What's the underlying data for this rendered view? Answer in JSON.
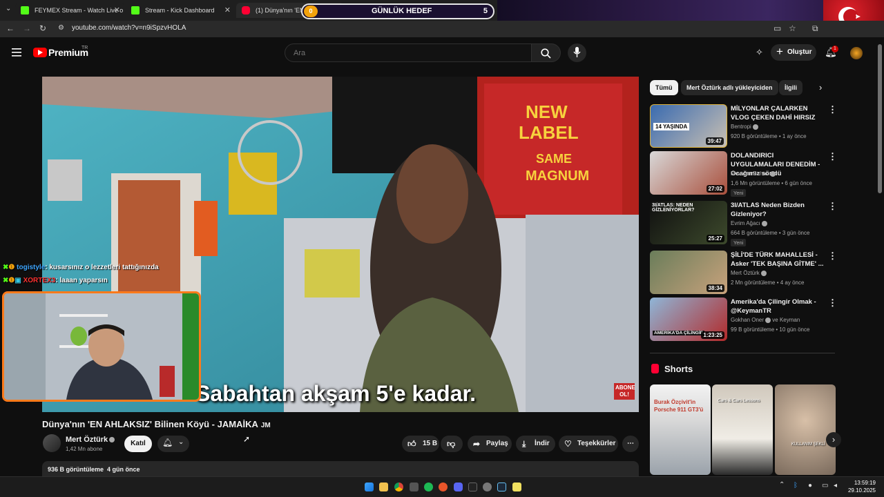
{
  "browser": {
    "tabs": [
      {
        "title": "FEYMEX Stream - Watch Live o",
        "color": "#53fc18"
      },
      {
        "title": "Stream - Kick Dashboard",
        "color": "#53fc18"
      },
      {
        "title": "(1) Dünya'nın 'EN AH",
        "color": "#ff0033"
      }
    ],
    "goal": {
      "label": "GÜNLÜK HEDEF",
      "current": "0",
      "target": "5"
    },
    "url": "youtube.com/watch?v=n9iSpzvHOLA"
  },
  "header": {
    "logo_text": "Premium",
    "logo_region": "TR",
    "search_placeholder": "Ara",
    "create_label": "Oluştur",
    "notif_count": "1"
  },
  "video": {
    "subtitle": "Sabahtan akşam 5'e kadar.",
    "watermark": "ABONE OL!",
    "title": "Dünya'nın 'EN AHLAKSIZ' Bilinen Köyü - JAMAİKA",
    "title_suffix": "JM",
    "channel": "Mert Öztürk",
    "subs": "1,42 Mn abone",
    "join_label": "Katıl",
    "likes": "15 B",
    "share_label": "Paylaş",
    "download_label": "İndir",
    "thanks_label": "Teşekkürler",
    "views": "936 B görüntüleme",
    "age": "4 gün önce"
  },
  "chat": [
    {
      "user": "togistyle",
      "text": ": kusarsınız o lezzetleri tattığınızda"
    },
    {
      "user": "XORTEX3",
      "text": ": laaan yaparsın"
    }
  ],
  "chips": [
    "Tümü",
    "Mert Öztürk adlı yükleyiciden",
    "İlgili"
  ],
  "recommendations": [
    {
      "title": "MİLYONLAR ÇALARKEN VLOG ÇEKEN DAHİ HIRSIZ",
      "channel": "Bentropi",
      "meta": "920 B görüntüleme • 1 ay önce",
      "duration": "39:47",
      "badge": "",
      "thumb_text": "14 YAŞINDA"
    },
    {
      "title": "DOLANDIRICI UYGULAMALARI DENEDİM - Ocağımız söndü",
      "channel": "Mevtcan Bahav",
      "meta": "1,6 Mn görüntüleme • 6 gün önce",
      "duration": "27:02",
      "badge": "Yeni",
      "thumb_text": ""
    },
    {
      "title": "3I/ATLAS Neden Bizden Gizleniyor?",
      "channel": "Evrim Ağacı",
      "meta": "664 B görüntüleme • 3 gün önce",
      "duration": "25:27",
      "badge": "Yeni",
      "thumb_text": "3I/ATLAS: NEDEN GİZLENİYORLAR?"
    },
    {
      "title": "ŞİLİ'DE TÜRK MAHALLESİ - Asker 'TEK BAŞINA GİTME' ...",
      "channel": "Mert Öztürk",
      "meta": "2 Mn görüntüleme • 4 ay önce",
      "duration": "38:34",
      "badge": "",
      "thumb_text": ""
    },
    {
      "title": "Amerika'da Çilingir Olmak - @KeymanTR",
      "channel": "Gokhan Oner",
      "channel_extra": "ve Keyman",
      "meta": "99 B görüntüleme • 10 gün önce",
      "duration": "1:23:25",
      "badge": "",
      "thumb_text": "AMERİKA'DA ÇİLİNGİR"
    }
  ],
  "shorts": {
    "label": "Shorts",
    "items": [
      {
        "text": "Burak Özçivit'in Porsche 911 GT3'ü"
      },
      {
        "text": "Cars & Cars Lessons"
      },
      {
        "text": "KULLANIM ŞEKLİ"
      }
    ]
  },
  "taskbar": {
    "time": "13:59:19",
    "date": "29.10.2025"
  },
  "colors": {
    "bg": "#0f0f0f",
    "accent": "#ff0000",
    "cam_border": "#ff7a1a"
  }
}
